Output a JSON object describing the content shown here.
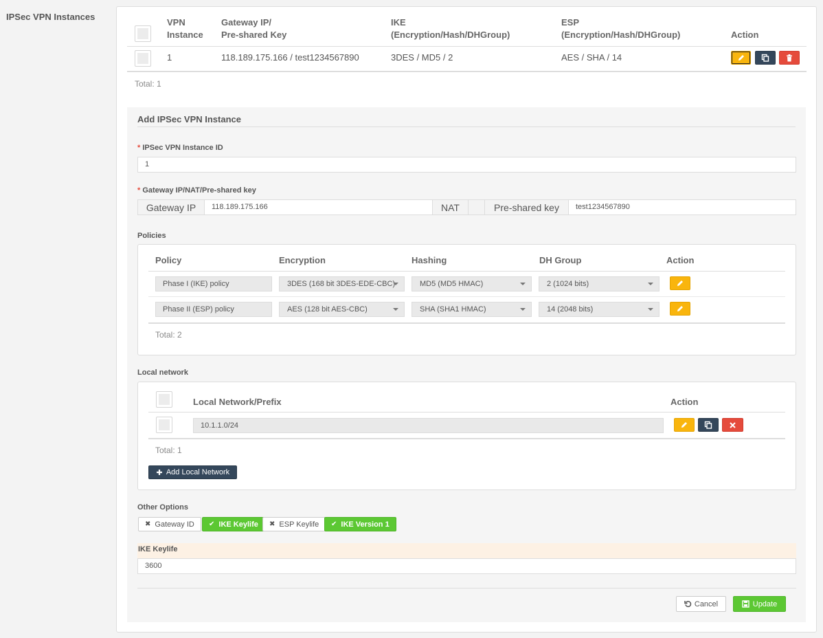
{
  "section_title": "IPSec VPN Instances",
  "instances_table": {
    "headers": {
      "vpn_instance_1": "VPN",
      "vpn_instance_2": "Instance",
      "gateway_1": "Gateway IP/",
      "gateway_2": "Pre-shared Key",
      "ike_1": "IKE",
      "ike_2": "(Encryption/Hash/DHGroup)",
      "esp_1": "ESP",
      "esp_2": "(Encryption/Hash/DHGroup)",
      "action": "Action"
    },
    "rows": [
      {
        "instance": "1",
        "gateway": "118.189.175.166 / test1234567890",
        "ike": "3DES / MD5 / 2",
        "esp": "AES / SHA / 14"
      }
    ],
    "total": "Total: 1"
  },
  "form": {
    "title": "Add IPSec VPN Instance",
    "instance_id_label": "IPSec VPN Instance ID",
    "instance_id_value": "1",
    "gateway_group_label": "Gateway IP/NAT/Pre-shared key",
    "gateway_ip_addon": "Gateway IP",
    "gateway_ip_value": "118.189.175.166",
    "nat_addon": "NAT",
    "psk_addon": "Pre-shared key",
    "psk_value": "test1234567890",
    "required_mark": "*"
  },
  "policies": {
    "label": "Policies",
    "headers": {
      "policy": "Policy",
      "encryption": "Encryption",
      "hashing": "Hashing",
      "dh_group": "DH Group",
      "action": "Action"
    },
    "rows": [
      {
        "policy": "Phase I (IKE) policy",
        "encryption": "3DES (168 bit 3DES-EDE-CBC)",
        "hashing": "MD5 (MD5 HMAC)",
        "dh_group": "2 (1024 bits)"
      },
      {
        "policy": "Phase II (ESP) policy",
        "encryption": "AES (128 bit AES-CBC)",
        "hashing": "SHA (SHA1 HMAC)",
        "dh_group": "14 (2048 bits)"
      }
    ],
    "total": "Total: 2"
  },
  "local_network": {
    "label": "Local network",
    "headers": {
      "prefix": "Local Network/Prefix",
      "action": "Action"
    },
    "rows": [
      {
        "prefix": "10.1.1.0/24"
      }
    ],
    "total": "Total: 1",
    "add_button": "Add Local Network"
  },
  "other_options": {
    "label": "Other Options",
    "items": [
      {
        "label": "Gateway ID",
        "enabled": false
      },
      {
        "label": "IKE Keylife",
        "enabled": true
      },
      {
        "label": "ESP Keylife",
        "enabled": false
      },
      {
        "label": "IKE Version 1",
        "enabled": true
      }
    ]
  },
  "ike_keylife": {
    "label": "IKE Keylife",
    "value": "3600"
  },
  "footer": {
    "cancel": "Cancel",
    "update": "Update"
  },
  "colors": {
    "accent_yellow": "#f9b50d",
    "dark": "#34475b",
    "danger": "#e54b3c",
    "success": "#5cc833",
    "highlight_row": "#fdf1e4"
  }
}
